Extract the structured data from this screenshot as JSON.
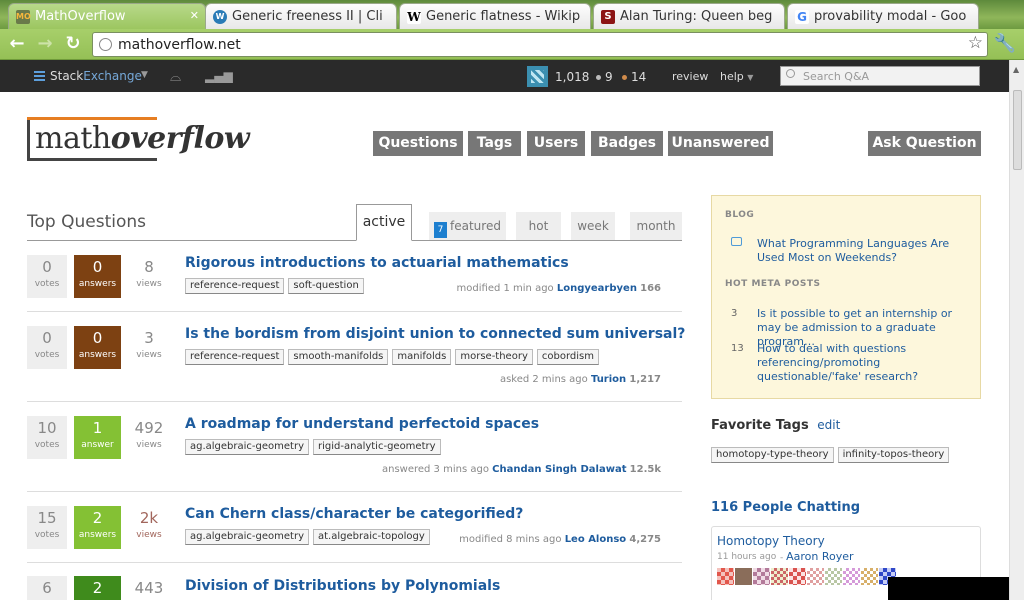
{
  "browser": {
    "tabs": [
      {
        "label": "MathOverflow",
        "favicon": "MO"
      },
      {
        "label": "Generic freeness II | Cli",
        "favicon": "wordpress"
      },
      {
        "label": "Generic flatness - Wikip",
        "favicon": "W"
      },
      {
        "label": "Alan Turing: Queen beg",
        "favicon": "S"
      },
      {
        "label": "provability modal - Goo",
        "favicon": "G"
      }
    ],
    "url": "mathoverflow.net"
  },
  "sebar": {
    "brand_a": "Stack",
    "brand_b": "Exchange",
    "reputation": "1,018",
    "silver": "9",
    "bronze": "14",
    "review": "review",
    "help": "help",
    "search_placeholder": "Search Q&A"
  },
  "header": {
    "logo_a": "math",
    "logo_b": "overflow",
    "nav": [
      "Questions",
      "Tags",
      "Users",
      "Badges",
      "Unanswered"
    ],
    "ask": "Ask Question"
  },
  "top_questions": {
    "title": "Top Questions",
    "tabs": [
      "active",
      "featured",
      "hot",
      "week",
      "month"
    ],
    "featured_count": "7"
  },
  "questions": [
    {
      "votes": "0",
      "votes_label": "votes",
      "answers": "0",
      "answers_label": "answers",
      "views": "8",
      "views_label": "views",
      "title": "Rigorous introductions to actuarial mathematics",
      "tags": [
        "reference-request",
        "soft-question"
      ],
      "action": "modified 1 min ago",
      "user": "Longyearbyen",
      "rep": "166"
    },
    {
      "votes": "0",
      "votes_label": "votes",
      "answers": "0",
      "answers_label": "answers",
      "views": "3",
      "views_label": "views",
      "title": "Is the bordism from disjoint union to connected sum universal?",
      "tags": [
        "reference-request",
        "smooth-manifolds",
        "manifolds",
        "morse-theory",
        "cobordism"
      ],
      "action": "asked 2 mins ago",
      "user": "Turion",
      "rep": "1,217"
    },
    {
      "votes": "10",
      "votes_label": "votes",
      "answers": "1",
      "answers_label": "answer",
      "views": "492",
      "views_label": "views",
      "title": "A roadmap for understand perfectoid spaces",
      "tags": [
        "ag.algebraic-geometry",
        "rigid-analytic-geometry"
      ],
      "action": "answered 3 mins ago",
      "user": "Chandan Singh Dalawat",
      "rep": "12.5k"
    },
    {
      "votes": "15",
      "votes_label": "votes",
      "answers": "2",
      "answers_label": "answers",
      "views": "2k",
      "views_label": "views",
      "title": "Can Chern class/character be categorified?",
      "tags": [
        "ag.algebraic-geometry",
        "at.algebraic-topology"
      ],
      "action": "modified 8 mins ago",
      "user": "Leo Alonso",
      "rep": "4,275"
    },
    {
      "votes": "6",
      "votes_label": "",
      "answers": "2",
      "answers_label": "",
      "views": "443",
      "views_label": "",
      "title": "Division of Distributions by Polynomials",
      "tags": [],
      "action": "",
      "user": "",
      "rep": ""
    }
  ],
  "sidebar": {
    "blog_heading": "BLOG",
    "blog_post": "What Programming Languages Are Used Most on Weekends?",
    "meta_heading": "HOT META POSTS",
    "meta_posts": [
      {
        "count": "3",
        "title": "Is it possible to get an internship or may be admission to a graduate program…"
      },
      {
        "count": "13",
        "title": "How to deal with questions referencing/promoting questionable/'fake' research?"
      }
    ],
    "fav_title": "Favorite Tags",
    "fav_edit": "edit",
    "fav_tags": [
      "homotopy-type-theory",
      "infinity-topos-theory"
    ],
    "chat_title": "116 People Chatting",
    "chat_room": "Homotopy Theory",
    "chat_when": "11 hours ago",
    "chat_user": "Aaron Royer"
  }
}
